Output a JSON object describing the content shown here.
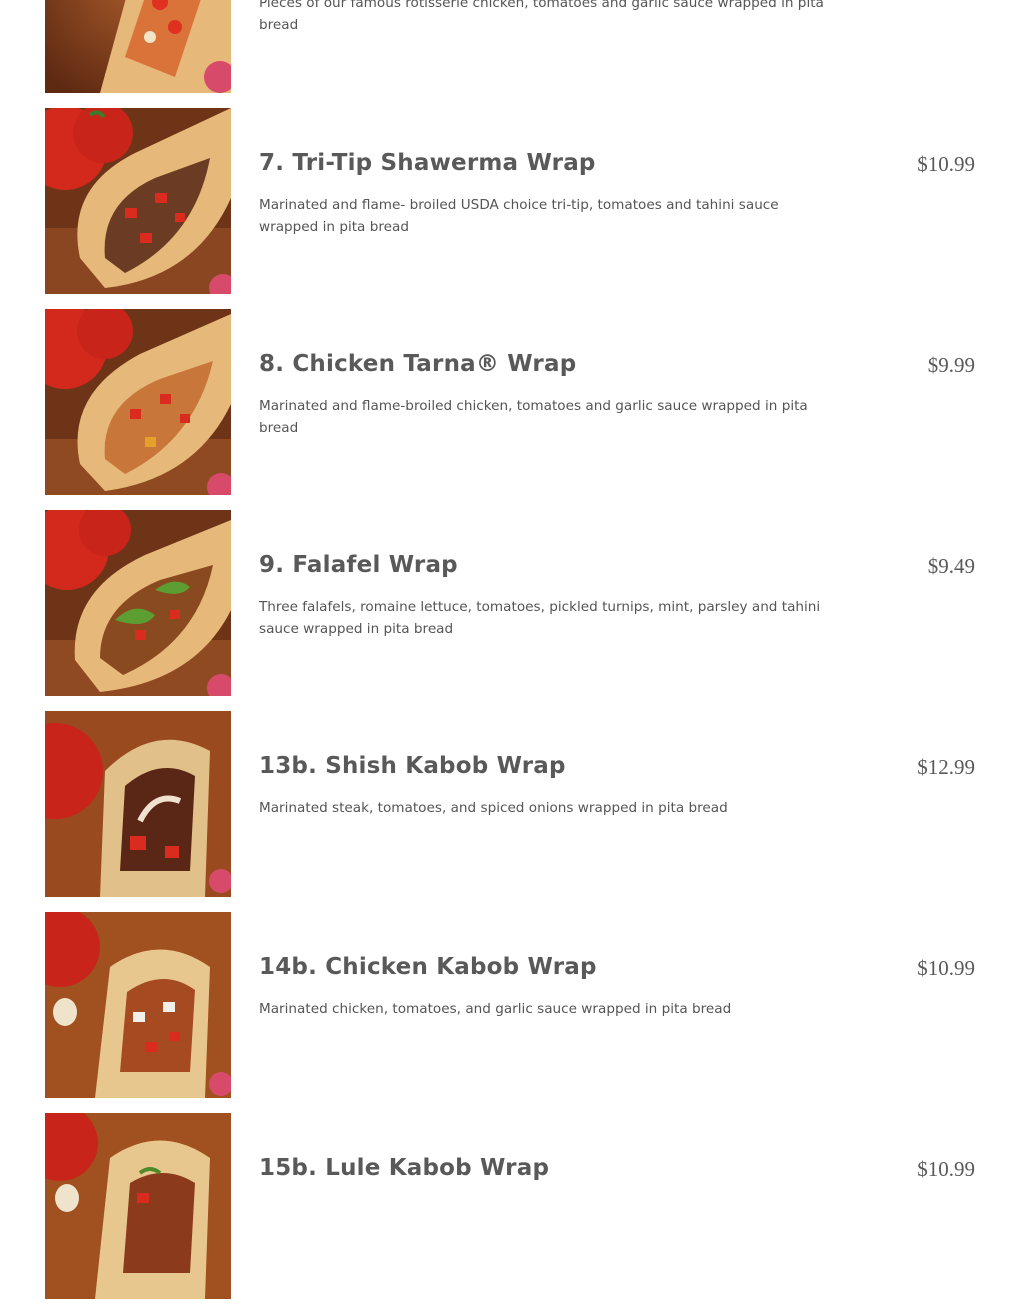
{
  "menu": {
    "items": [
      {
        "name": "",
        "price": "",
        "description": "Pieces of our famous rotisserie chicken, tomatoes and garlic sauce wrapped in pita bread",
        "image_icon": "chicken-wrap-photo"
      },
      {
        "name": "7. Tri-Tip Shawerma Wrap",
        "price": "$10.99",
        "description": "Marinated and flame- broiled USDA choice tri-tip, tomatoes and tahini sauce wrapped in pita bread",
        "image_icon": "tri-tip-wrap-photo"
      },
      {
        "name": "8. Chicken Tarna® Wrap",
        "price": "$9.99",
        "description": "Marinated and flame-broiled chicken, tomatoes and garlic sauce wrapped in pita bread",
        "image_icon": "chicken-tarna-wrap-photo"
      },
      {
        "name": "9. Falafel Wrap",
        "price": "$9.49",
        "description": "Three falafels, romaine lettuce, tomatoes, pickled turnips, mint, parsley and tahini sauce wrapped in pita bread",
        "image_icon": "falafel-wrap-photo"
      },
      {
        "name": "13b. Shish Kabob Wrap",
        "price": "$12.99",
        "description": "Marinated steak, tomatoes, and spiced onions wrapped in pita bread",
        "image_icon": "shish-kabob-wrap-photo"
      },
      {
        "name": "14b. Chicken Kabob Wrap",
        "price": "$10.99",
        "description": "Marinated chicken, tomatoes, and garlic sauce wrapped in pita bread",
        "image_icon": "chicken-kabob-wrap-photo"
      },
      {
        "name": "15b. Lule Kabob Wrap",
        "price": "$10.99",
        "description": "",
        "image_icon": "lule-kabob-wrap-photo"
      }
    ]
  },
  "colors": {
    "text_heading": "#595959",
    "text_body": "#555555",
    "background": "#ffffff",
    "tomato_red": "#d3291c",
    "wood_brown": "#7a3b1c",
    "pita_tan": "#e6b879"
  }
}
